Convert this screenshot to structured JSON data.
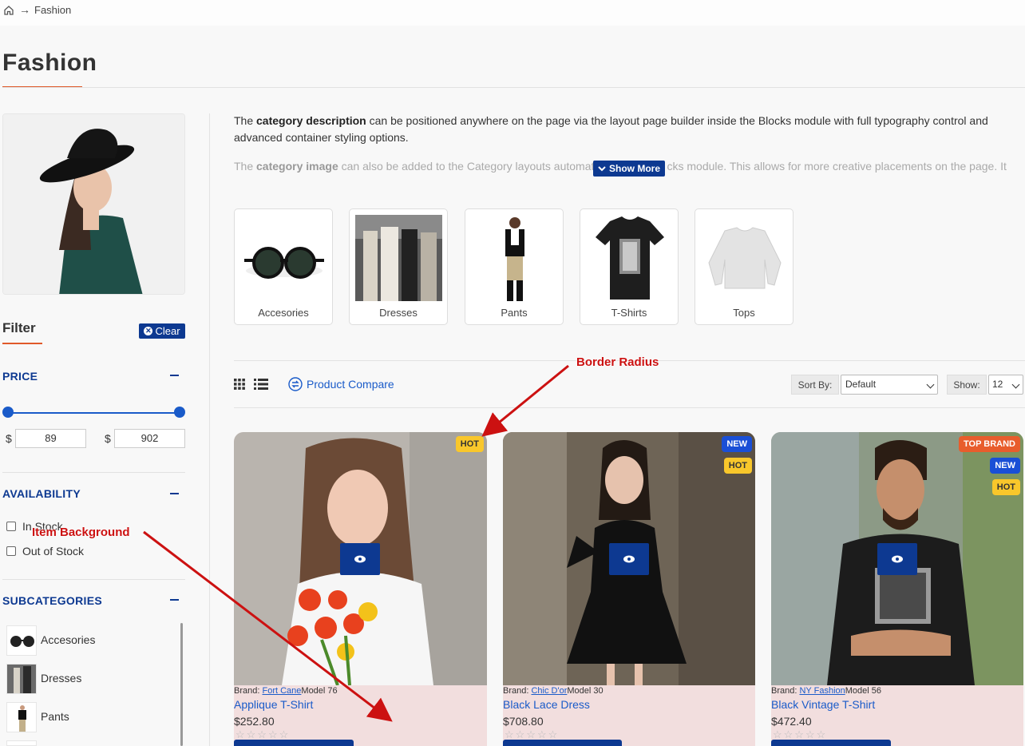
{
  "breadcrumb": {
    "separator": "→",
    "current": "Fashion"
  },
  "page": {
    "title": "Fashion"
  },
  "sidebar": {
    "filter_title": "Filter",
    "clear_label": "Clear",
    "price": {
      "title": "PRICE",
      "currency": "$",
      "min": "89",
      "max": "902"
    },
    "availability": {
      "title": "AVAILABILITY",
      "options": [
        "In Stock",
        "Out of Stock"
      ]
    },
    "subcategories": {
      "title": "SUBCATEGORIES",
      "items": [
        "Accesories",
        "Dresses",
        "Pants"
      ]
    }
  },
  "description": {
    "p1_lead": "The",
    "p1_bold": "category description",
    "p1_rest": "can be positioned anywhere on the page via the layout page builder inside the Blocks module with full typography control and advanced container styling options.",
    "p2_lead": "The",
    "p2_bold": "category image",
    "p2_rest_before": "can also be added to the Category layouts automati",
    "p2_rest_after": "cks module. This allows for more creative placements on the page. It",
    "show_more": "Show More"
  },
  "categories": [
    "Accesories",
    "Dresses",
    "Pants",
    "T-Shirts",
    "Tops"
  ],
  "toolbar": {
    "compare": "Product Compare",
    "sort_label": "Sort By:",
    "sort_value": "Default",
    "show_label": "Show:",
    "show_value": "12"
  },
  "products": [
    {
      "brand_label": "Brand:",
      "brand": "Fort Cane",
      "model": "Model 76",
      "name": "Applique T-Shirt",
      "price": "$252.80",
      "badges": [
        "HOT"
      ]
    },
    {
      "brand_label": "Brand:",
      "brand": "Chic D'or",
      "model": "Model 30",
      "name": "Black Lace Dress",
      "price": "$708.80",
      "badges": [
        "NEW",
        "HOT"
      ]
    },
    {
      "brand_label": "Brand:",
      "brand": "NY Fashion",
      "model": "Model 56",
      "name": "Black Vintage T-Shirt",
      "price": "$472.40",
      "badges": [
        "TOP BRAND",
        "NEW",
        "HOT"
      ]
    }
  ],
  "annotations": {
    "border_radius": "Border Radius",
    "item_background": "Item Background"
  },
  "colors": {
    "accent": "#0d3991",
    "link": "#1a5bc9",
    "item_bg": "#f2dede",
    "hot": "#f9c72b",
    "new": "#1a4fd6",
    "top_brand": "#e85d2c",
    "title_accent": "#e05a2a"
  }
}
